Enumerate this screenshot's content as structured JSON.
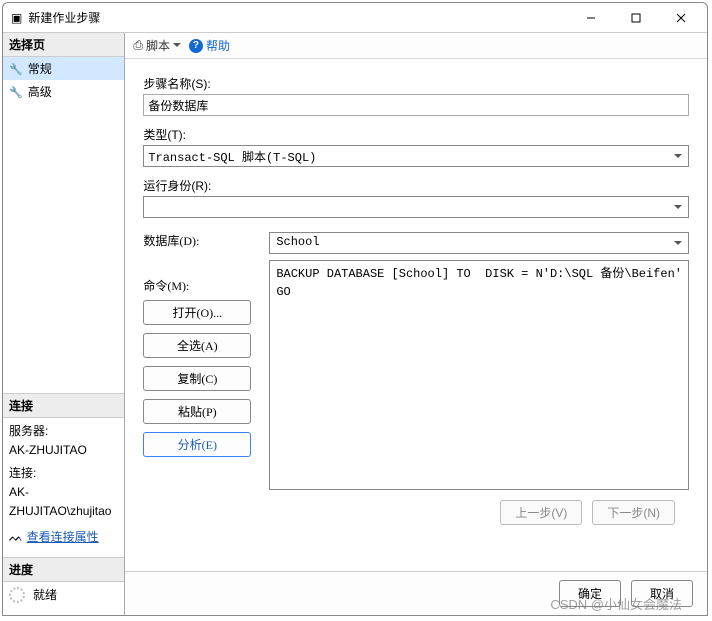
{
  "window": {
    "title": "新建作业步骤"
  },
  "sidebar": {
    "select_header": "选择页",
    "items": [
      {
        "label": "常规",
        "selected": true
      },
      {
        "label": "高级",
        "selected": false
      }
    ],
    "connection": {
      "header": "连接",
      "server_label": "服务器:",
      "server_value": "AK-ZHUJITAO",
      "conn_label": "连接:",
      "conn_value": "AK-ZHUJITAO\\zhujitao",
      "view_props": "查看连接属性"
    },
    "progress": {
      "header": "进度",
      "status": "就绪"
    }
  },
  "toolbar": {
    "script": "脚本",
    "help": "帮助"
  },
  "form": {
    "step_name_label": "步骤名称(S):",
    "step_name_value": "备份数据库",
    "type_label": "类型(T):",
    "type_value": "Transact-SQL 脚本(T-SQL)",
    "run_as_label": "运行身份(R):",
    "run_as_value": "",
    "database_label": "数据库(D):",
    "database_value": "School",
    "command_label": "命令(M):",
    "command_value": "BACKUP DATABASE [School] TO  DISK = N'D:\\SQL 备份\\Beifen'\nGO",
    "buttons": {
      "open": "打开(O)...",
      "select_all": "全选(A)",
      "copy": "复制(C)",
      "paste": "粘贴(P)",
      "parse": "分析(E)"
    },
    "nav": {
      "prev": "上一步(V)",
      "next": "下一步(N)"
    }
  },
  "dialog_buttons": {
    "ok": "确定",
    "cancel": "取消"
  },
  "watermark": "CSDN @小仙女会魔法"
}
